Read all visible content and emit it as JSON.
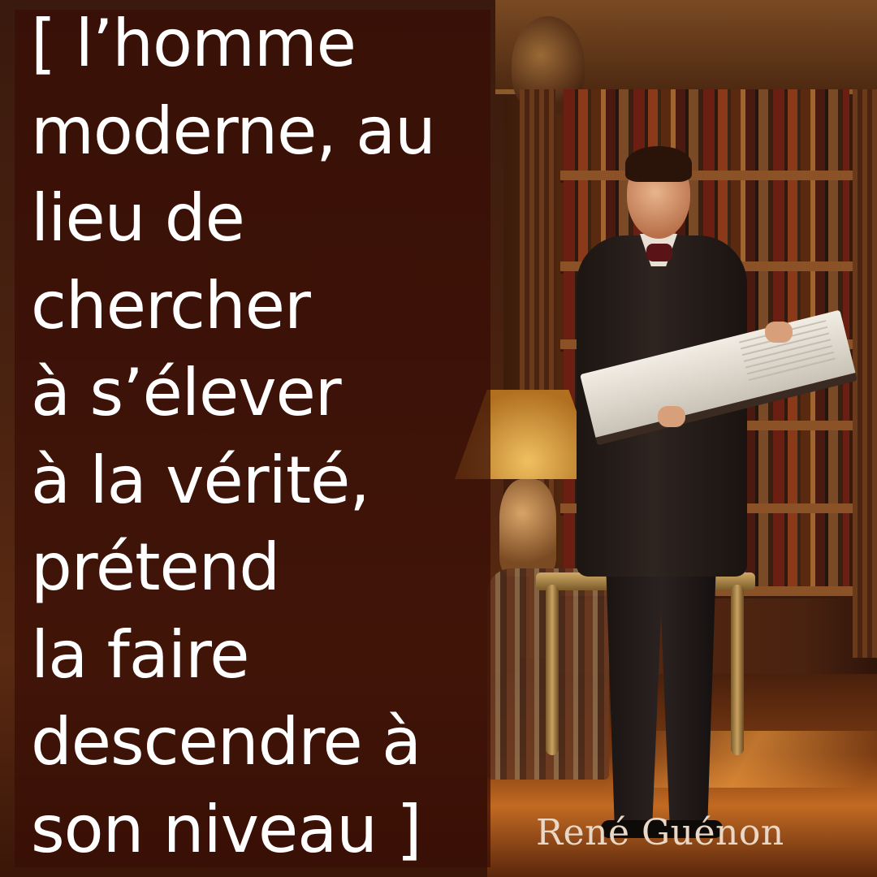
{
  "quote": {
    "lines": [
      "[ l’homme",
      "moderne, au",
      "lieu de",
      "chercher",
      "à s’élever",
      "à la vérité,",
      "prétend",
      "la faire",
      "descendre à",
      "son niveau ]"
    ]
  },
  "author": "René Guénon",
  "colors": {
    "panel": "#380e06",
    "quote_text": "#ffffff",
    "author_text": "#ead8c6"
  }
}
